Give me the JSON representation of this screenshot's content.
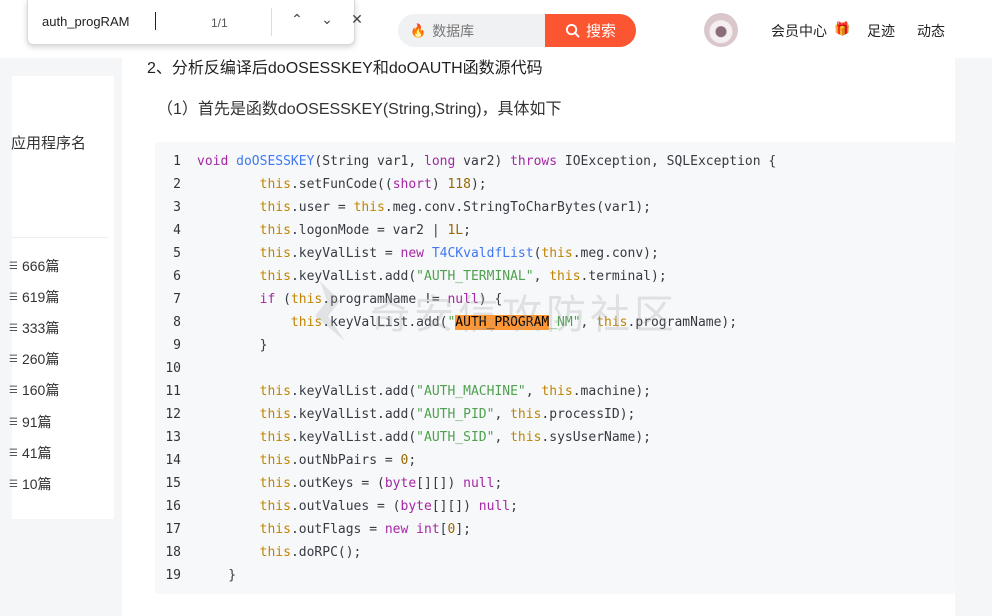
{
  "findbar": {
    "query": "auth_progRAM",
    "count": "1/1",
    "prev_icon": "chevron-up-icon",
    "next_icon": "chevron-down-icon",
    "close_icon": "close-icon"
  },
  "header": {
    "search_placeholder": "数据库",
    "search_button": "搜索",
    "nav": [
      "会员中心",
      "足迹",
      "动态"
    ]
  },
  "left_panel": {
    "label": "应用程序名",
    "counts": [
      "666篇",
      "619篇",
      "333篇",
      "260篇",
      "160篇",
      "91篇",
      "41篇",
      "10篇"
    ]
  },
  "article": {
    "heading": "2、分析反编译后doOSESSKEY和doOAUTH函数源代码",
    "subheading": "（1）首先是函数doOSESSKEY(String,String)，具体如下"
  },
  "code": {
    "line_numbers": [
      "1",
      "2",
      "3",
      "4",
      "5",
      "6",
      "7",
      "8",
      "9",
      "10",
      "11",
      "12",
      "13",
      "14",
      "15",
      "16",
      "17",
      "18",
      "19"
    ],
    "highlight_match": "AUTH_PROGRAM"
  },
  "watermark": "奇安信攻防社区",
  "colors": {
    "accent": "#fc5531",
    "find_highlight": "#ff9632"
  }
}
